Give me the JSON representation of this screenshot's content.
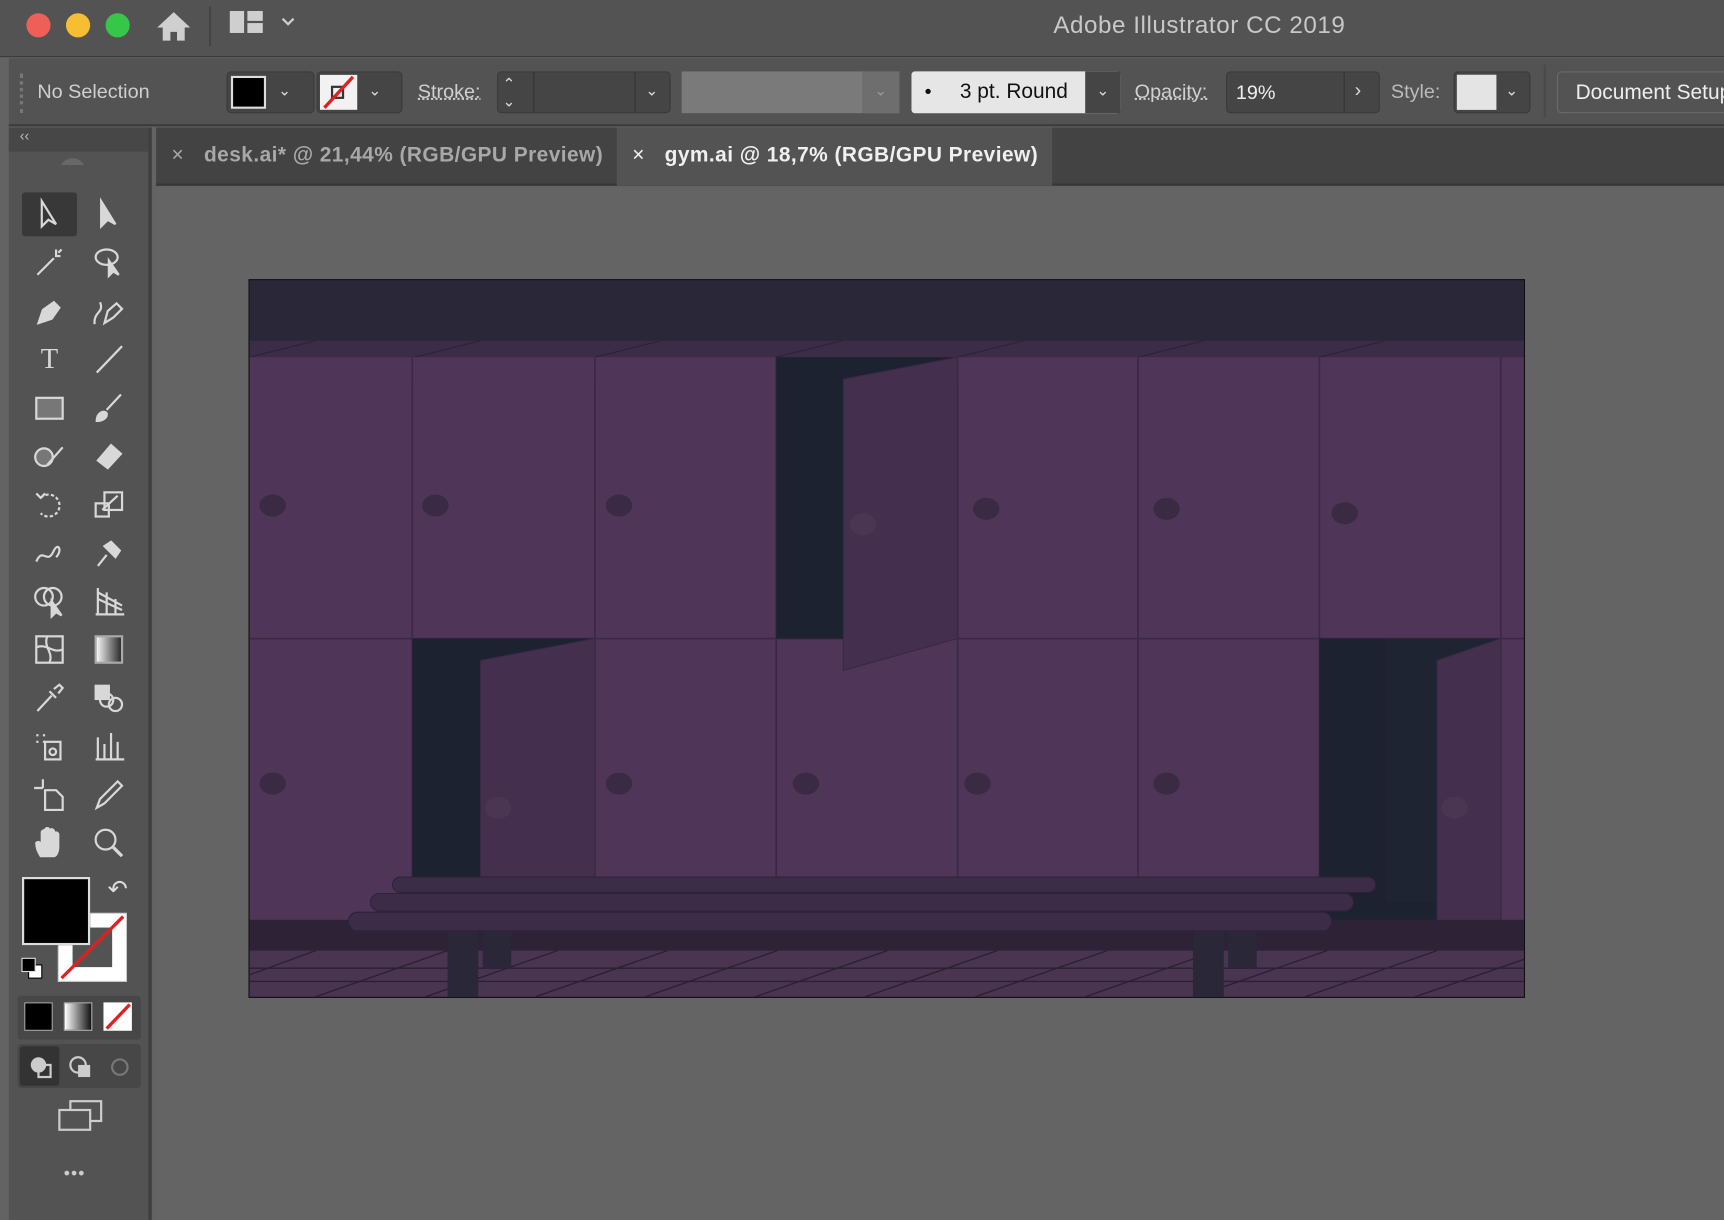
{
  "window": {
    "title": "Adobe Illustrator CC 2019"
  },
  "control_bar": {
    "selection": "No Selection",
    "stroke_label": "Stroke:",
    "brush": "3 pt. Round",
    "brush_dot": "•",
    "opacity_label": "Opacity:",
    "opacity_value": "19%",
    "style_label": "Style:",
    "document_setup": "Document Setup"
  },
  "tabs": [
    {
      "label": "desk.ai* @ 21,44% (RGB/GPU Preview)",
      "active": false
    },
    {
      "label": "gym.ai @ 18,7% (RGB/GPU Preview)",
      "active": true
    }
  ],
  "tab_close": "×",
  "toolbar": {
    "collapse": "‹‹",
    "more": "•••"
  },
  "colors": {
    "locker": "#4f3658",
    "interior": "#1c2230",
    "door": "#442f4e",
    "ceiling": "#2a2838"
  }
}
